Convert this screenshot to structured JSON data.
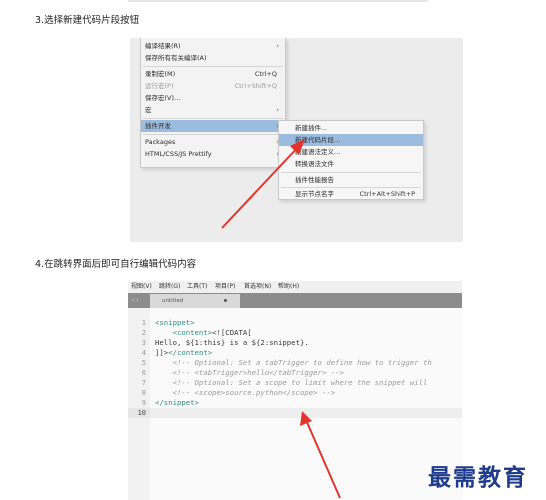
{
  "steps": {
    "step3": "3.选择新建代码片段按钮",
    "step4": "4.在跳转界面后即可自行编辑代码内容"
  },
  "menu1": {
    "items": [
      {
        "label": "编译结果(R)",
        "shortcut": "",
        "arrow": "›",
        "state": "normal"
      },
      {
        "label": "保存所有有关编译(A)",
        "shortcut": "",
        "arrow": "",
        "state": "normal"
      },
      {
        "label": "录制宏(M)",
        "shortcut": "Ctrl+Q",
        "arrow": "",
        "state": "normal"
      },
      {
        "label": "运行宏(P)",
        "shortcut": "Ctrl+Shift+Q",
        "arrow": "",
        "state": "disabled"
      },
      {
        "label": "保存宏(V)...",
        "shortcut": "",
        "arrow": "",
        "state": "normal"
      },
      {
        "label": "宏",
        "shortcut": "",
        "arrow": "›",
        "state": "normal"
      },
      {
        "label": "插件开发",
        "shortcut": "",
        "arrow": "›",
        "state": "highlight"
      },
      {
        "label": "Packages",
        "shortcut": "",
        "arrow": "›",
        "state": "normal"
      },
      {
        "label": "HTML/CSS/JS Prettify",
        "shortcut": "",
        "arrow": "›",
        "state": "normal"
      }
    ]
  },
  "menu2": {
    "items": [
      {
        "label": "新建插件...",
        "shortcut": "",
        "state": "normal"
      },
      {
        "label": "新建代码片段...",
        "shortcut": "",
        "state": "highlight"
      },
      {
        "label": "新建语法定义...",
        "shortcut": "",
        "state": "normal"
      },
      {
        "label": "转换语法文件",
        "shortcut": "",
        "state": "normal"
      },
      {
        "label": "插件性能报告",
        "shortcut": "",
        "state": "normal"
      },
      {
        "label": "显示节点名字",
        "shortcut": "Ctrl+Alt+Shift+P",
        "state": "normal"
      }
    ]
  },
  "editor": {
    "menubar": [
      "视图(V)",
      "跳转(G)",
      "工具(T)",
      "项目(P)",
      "首选项(N)",
      "帮助(H)"
    ],
    "nav": "‹ ›",
    "tab_title": "untitled",
    "line_numbers": [
      "1",
      "2",
      "3",
      "4",
      "5",
      "6",
      "7",
      "8",
      "9",
      "10"
    ],
    "lines": [
      [
        {
          "t": "<snippet>",
          "c": "tag"
        }
      ],
      [
        {
          "t": "    <content>",
          "c": "tag"
        },
        {
          "t": "<![CDATA[",
          "c": "txt"
        }
      ],
      [
        {
          "t": "Hello, ${1:this} is a ${2:snippet}.",
          "c": "txt"
        }
      ],
      [
        {
          "t": "]]>",
          "c": "txt"
        },
        {
          "t": "</content>",
          "c": "tag"
        }
      ],
      [
        {
          "t": "    <!-- Optional: Set a tabTrigger to define how to trigger th",
          "c": "com"
        }
      ],
      [
        {
          "t": "    <!-- <tabTrigger>hello</tabTrigger> -->",
          "c": "com"
        }
      ],
      [
        {
          "t": "    <!-- Optional: Set a scope to limit where the snippet will",
          "c": "com"
        }
      ],
      [
        {
          "t": "    <!-- <scope>source.python</scope> -->",
          "c": "com"
        }
      ],
      [
        {
          "t": "</snippet>",
          "c": "tag"
        }
      ],
      []
    ],
    "current_line": 10
  },
  "watermark": "最需教育",
  "colors": {
    "highlight": "#9cbcdf",
    "arrow": "#e3342f",
    "tag": "#2f8f7f",
    "comment": "#9b9b9b",
    "watermark": "#1f3c8c"
  }
}
